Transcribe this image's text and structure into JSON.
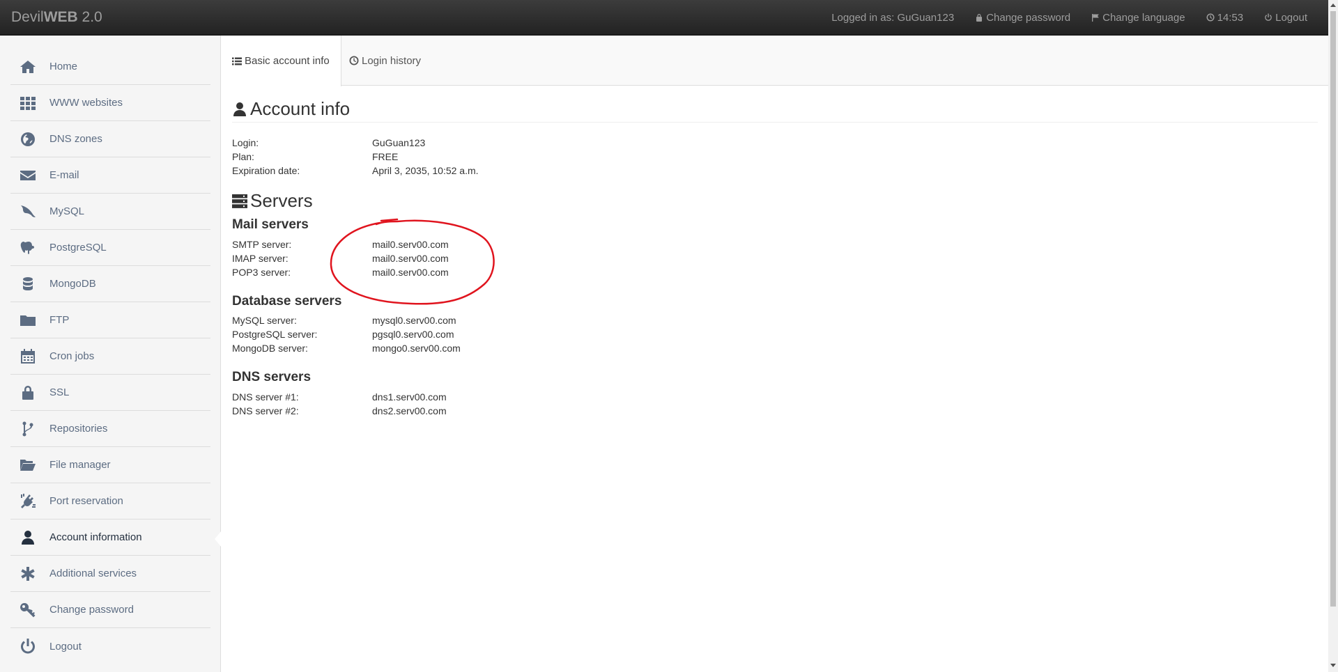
{
  "brand": {
    "prefix": "Devil",
    "bold": "WEB",
    "version": " 2.0"
  },
  "topbar": {
    "logged_in": "Logged in as: GuGuan123",
    "change_password": "Change password",
    "change_language": "Change language",
    "time": "14:53",
    "logout": "Logout"
  },
  "sidebar": {
    "items": [
      {
        "label": "Home",
        "icon": "home-icon"
      },
      {
        "label": "WWW websites",
        "icon": "grid-icon"
      },
      {
        "label": "DNS zones",
        "icon": "globe-icon"
      },
      {
        "label": "E-mail",
        "icon": "envelope-icon"
      },
      {
        "label": "MySQL",
        "icon": "dolphin-icon"
      },
      {
        "label": "PostgreSQL",
        "icon": "elephant-icon"
      },
      {
        "label": "MongoDB",
        "icon": "database-icon"
      },
      {
        "label": "FTP",
        "icon": "folder-icon"
      },
      {
        "label": "Cron jobs",
        "icon": "calendar-icon"
      },
      {
        "label": "SSL",
        "icon": "lock-icon"
      },
      {
        "label": "Repositories",
        "icon": "branch-icon"
      },
      {
        "label": "File manager",
        "icon": "folder-open-icon"
      },
      {
        "label": "Port reservation",
        "icon": "plug-icon"
      },
      {
        "label": "Account information",
        "icon": "user-icon"
      },
      {
        "label": "Additional services",
        "icon": "asterisk-icon"
      },
      {
        "label": "Change password",
        "icon": "key-icon"
      },
      {
        "label": "Logout",
        "icon": "power-icon"
      }
    ],
    "active": "Account information"
  },
  "tabs": [
    {
      "label": "Basic account info",
      "icon": "list-icon"
    },
    {
      "label": "Login history",
      "icon": "clock-icon"
    }
  ],
  "account": {
    "title": "Account info",
    "login_label": "Login:",
    "login": "GuGuan123",
    "plan_label": "Plan:",
    "plan": "FREE",
    "expiration_label": "Expiration date:",
    "expiration": "April 3, 2035, 10:52 a.m."
  },
  "servers": {
    "title": "Servers",
    "mail": {
      "title": "Mail servers",
      "smtp_label": "SMTP server:",
      "smtp": "mail0.serv00.com",
      "imap_label": "IMAP server:",
      "imap": "mail0.serv00.com",
      "pop3_label": "POP3 server:",
      "pop3": "mail0.serv00.com"
    },
    "database": {
      "title": "Database servers",
      "mysql_label": "MySQL server:",
      "mysql": "mysql0.serv00.com",
      "pgsql_label": "PostgreSQL server:",
      "pgsql": "pgsql0.serv00.com",
      "mongo_label": "MongoDB server:",
      "mongo": "mongo0.serv00.com"
    },
    "dns": {
      "title": "DNS servers",
      "dns1_label": "DNS server #1:",
      "dns1": "dns1.serv00.com",
      "dns2_label": "DNS server #2:",
      "dns2": "dns2.serv00.com"
    }
  },
  "colors": {
    "annotation": "#e0141e",
    "sidebar_text": "#5c6c82",
    "active_text": "#24303f"
  }
}
